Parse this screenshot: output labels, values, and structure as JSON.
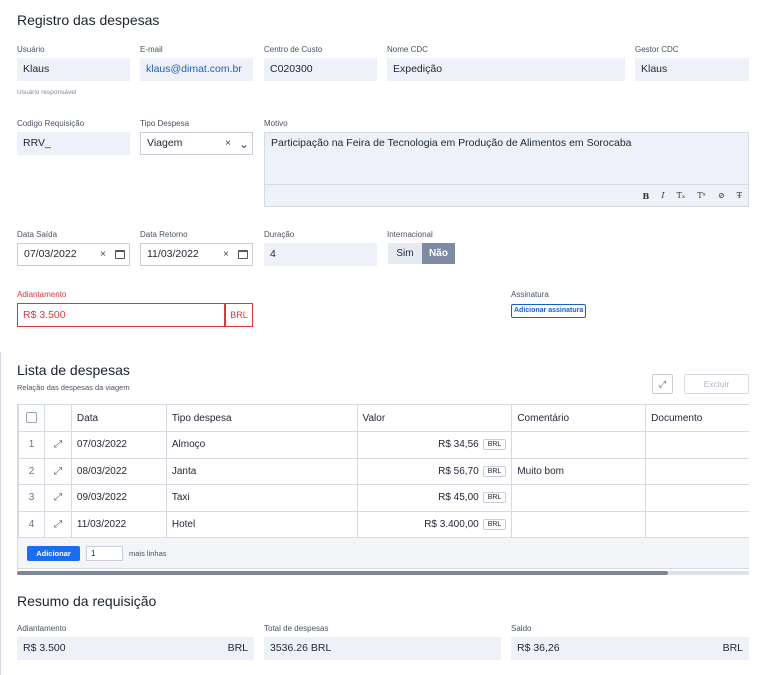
{
  "registro": {
    "title": "Registro das despesas",
    "usuario": {
      "label": "Usuário",
      "value": "Klaus",
      "hint": "Usuário responsável"
    },
    "email": {
      "label": "E-mail",
      "value": "klaus@dimat.com.br"
    },
    "centro_custo": {
      "label": "Centro de Custo",
      "value": "C020300"
    },
    "nome_cdc": {
      "label": "Nome CDC",
      "value": "Expedição"
    },
    "gestor_cdc": {
      "label": "Gestor CDC",
      "value": "Klaus"
    },
    "codigo_requisicao": {
      "label": "Codigo Requisição",
      "value": "RRV_"
    },
    "tipo_despesa": {
      "label": "Tipo Despesa",
      "value": "Viagem",
      "clear": "×",
      "chevron": "⌄"
    },
    "motivo": {
      "label": "Motivo",
      "value": "Participação na Feira de Tecnologia em Produção de Alimentos em Sorocaba",
      "toolbar": [
        "B",
        "I",
        "Tₓ",
        "Tˣ",
        "⊘",
        "T̶"
      ]
    },
    "data_saida": {
      "label": "Data Saída",
      "value": "07/03/2022",
      "clear": "×"
    },
    "data_retorno": {
      "label": "Data Retorno",
      "value": "11/03/2022",
      "clear": "×"
    },
    "duracao": {
      "label": "Duração",
      "value": "4"
    },
    "internacional": {
      "label": "Internacional",
      "sim": "Sim",
      "nao": "Não",
      "selected": "Não"
    },
    "adiantamento": {
      "label": "Adiantamento",
      "value": "R$ 3.500",
      "currency": "BRL"
    },
    "assinatura": {
      "label": "Assinatura",
      "button": "Adicionar assinatura"
    }
  },
  "lista": {
    "title": "Lista de despesas",
    "subtitle": "Relação das despesas da viagem",
    "excluir": "Excluir",
    "headers": [
      "Data",
      "Tipo despesa",
      "Valor",
      "Comentário",
      "Documento"
    ],
    "rows": [
      {
        "n": "1",
        "data": "07/03/2022",
        "tipo": "Almoço",
        "valor": "R$ 34,56",
        "cur": "BRL",
        "comentario": ""
      },
      {
        "n": "2",
        "data": "08/03/2022",
        "tipo": "Janta",
        "valor": "R$ 56,70",
        "cur": "BRL",
        "comentario": "Muito bom"
      },
      {
        "n": "3",
        "data": "09/03/2022",
        "tipo": "Taxi",
        "valor": "R$ 45,00",
        "cur": "BRL",
        "comentario": ""
      },
      {
        "n": "4",
        "data": "11/03/2022",
        "tipo": "Hotel",
        "valor": "R$ 3.400,00",
        "cur": "BRL",
        "comentario": ""
      }
    ],
    "adicionar": "Adicionar",
    "qtd": "1",
    "mais_linhas": "mais linhas"
  },
  "resumo": {
    "title": "Resumo da requisição",
    "adiantamento": {
      "label": "Adiantamento",
      "value": "R$ 3.500",
      "currency": "BRL"
    },
    "total": {
      "label": "Total de despesas",
      "value": "3536.26 BRL"
    },
    "saldo": {
      "label": "Saldo",
      "value": "R$ 36,26",
      "currency": "BRL"
    }
  },
  "colors": {
    "accent": "#1a6cf0",
    "field_bg": "#eef2f8",
    "error": "#d93939",
    "toggle_selected": "#7f8aa3"
  }
}
